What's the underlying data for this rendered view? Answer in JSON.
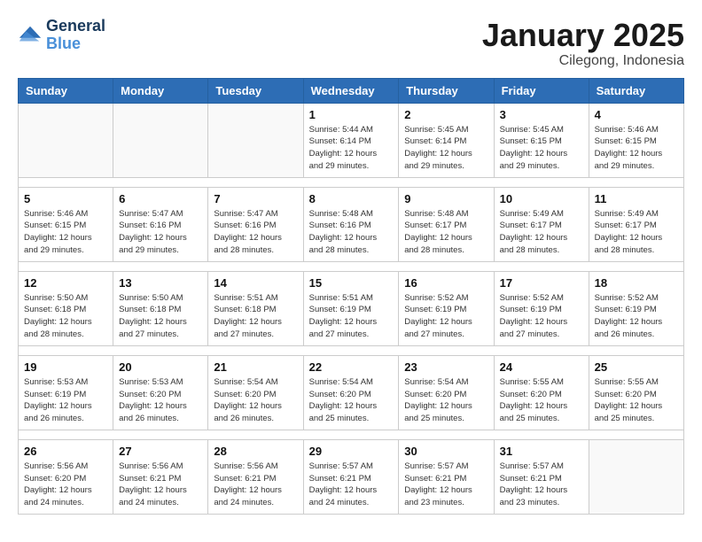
{
  "logo": {
    "text_general": "General",
    "text_blue": "Blue"
  },
  "header": {
    "title": "January 2025",
    "subtitle": "Cilegong, Indonesia"
  },
  "weekdays": [
    "Sunday",
    "Monday",
    "Tuesday",
    "Wednesday",
    "Thursday",
    "Friday",
    "Saturday"
  ],
  "weeks": [
    [
      {
        "day": "",
        "info": ""
      },
      {
        "day": "",
        "info": ""
      },
      {
        "day": "",
        "info": ""
      },
      {
        "day": "1",
        "info": "Sunrise: 5:44 AM\nSunset: 6:14 PM\nDaylight: 12 hours\nand 29 minutes."
      },
      {
        "day": "2",
        "info": "Sunrise: 5:45 AM\nSunset: 6:14 PM\nDaylight: 12 hours\nand 29 minutes."
      },
      {
        "day": "3",
        "info": "Sunrise: 5:45 AM\nSunset: 6:15 PM\nDaylight: 12 hours\nand 29 minutes."
      },
      {
        "day": "4",
        "info": "Sunrise: 5:46 AM\nSunset: 6:15 PM\nDaylight: 12 hours\nand 29 minutes."
      }
    ],
    [
      {
        "day": "5",
        "info": "Sunrise: 5:46 AM\nSunset: 6:15 PM\nDaylight: 12 hours\nand 29 minutes."
      },
      {
        "day": "6",
        "info": "Sunrise: 5:47 AM\nSunset: 6:16 PM\nDaylight: 12 hours\nand 29 minutes."
      },
      {
        "day": "7",
        "info": "Sunrise: 5:47 AM\nSunset: 6:16 PM\nDaylight: 12 hours\nand 28 minutes."
      },
      {
        "day": "8",
        "info": "Sunrise: 5:48 AM\nSunset: 6:16 PM\nDaylight: 12 hours\nand 28 minutes."
      },
      {
        "day": "9",
        "info": "Sunrise: 5:48 AM\nSunset: 6:17 PM\nDaylight: 12 hours\nand 28 minutes."
      },
      {
        "day": "10",
        "info": "Sunrise: 5:49 AM\nSunset: 6:17 PM\nDaylight: 12 hours\nand 28 minutes."
      },
      {
        "day": "11",
        "info": "Sunrise: 5:49 AM\nSunset: 6:17 PM\nDaylight: 12 hours\nand 28 minutes."
      }
    ],
    [
      {
        "day": "12",
        "info": "Sunrise: 5:50 AM\nSunset: 6:18 PM\nDaylight: 12 hours\nand 28 minutes."
      },
      {
        "day": "13",
        "info": "Sunrise: 5:50 AM\nSunset: 6:18 PM\nDaylight: 12 hours\nand 27 minutes."
      },
      {
        "day": "14",
        "info": "Sunrise: 5:51 AM\nSunset: 6:18 PM\nDaylight: 12 hours\nand 27 minutes."
      },
      {
        "day": "15",
        "info": "Sunrise: 5:51 AM\nSunset: 6:19 PM\nDaylight: 12 hours\nand 27 minutes."
      },
      {
        "day": "16",
        "info": "Sunrise: 5:52 AM\nSunset: 6:19 PM\nDaylight: 12 hours\nand 27 minutes."
      },
      {
        "day": "17",
        "info": "Sunrise: 5:52 AM\nSunset: 6:19 PM\nDaylight: 12 hours\nand 27 minutes."
      },
      {
        "day": "18",
        "info": "Sunrise: 5:52 AM\nSunset: 6:19 PM\nDaylight: 12 hours\nand 26 minutes."
      }
    ],
    [
      {
        "day": "19",
        "info": "Sunrise: 5:53 AM\nSunset: 6:19 PM\nDaylight: 12 hours\nand 26 minutes."
      },
      {
        "day": "20",
        "info": "Sunrise: 5:53 AM\nSunset: 6:20 PM\nDaylight: 12 hours\nand 26 minutes."
      },
      {
        "day": "21",
        "info": "Sunrise: 5:54 AM\nSunset: 6:20 PM\nDaylight: 12 hours\nand 26 minutes."
      },
      {
        "day": "22",
        "info": "Sunrise: 5:54 AM\nSunset: 6:20 PM\nDaylight: 12 hours\nand 25 minutes."
      },
      {
        "day": "23",
        "info": "Sunrise: 5:54 AM\nSunset: 6:20 PM\nDaylight: 12 hours\nand 25 minutes."
      },
      {
        "day": "24",
        "info": "Sunrise: 5:55 AM\nSunset: 6:20 PM\nDaylight: 12 hours\nand 25 minutes."
      },
      {
        "day": "25",
        "info": "Sunrise: 5:55 AM\nSunset: 6:20 PM\nDaylight: 12 hours\nand 25 minutes."
      }
    ],
    [
      {
        "day": "26",
        "info": "Sunrise: 5:56 AM\nSunset: 6:20 PM\nDaylight: 12 hours\nand 24 minutes."
      },
      {
        "day": "27",
        "info": "Sunrise: 5:56 AM\nSunset: 6:21 PM\nDaylight: 12 hours\nand 24 minutes."
      },
      {
        "day": "28",
        "info": "Sunrise: 5:56 AM\nSunset: 6:21 PM\nDaylight: 12 hours\nand 24 minutes."
      },
      {
        "day": "29",
        "info": "Sunrise: 5:57 AM\nSunset: 6:21 PM\nDaylight: 12 hours\nand 24 minutes."
      },
      {
        "day": "30",
        "info": "Sunrise: 5:57 AM\nSunset: 6:21 PM\nDaylight: 12 hours\nand 23 minutes."
      },
      {
        "day": "31",
        "info": "Sunrise: 5:57 AM\nSunset: 6:21 PM\nDaylight: 12 hours\nand 23 minutes."
      },
      {
        "day": "",
        "info": ""
      }
    ]
  ]
}
